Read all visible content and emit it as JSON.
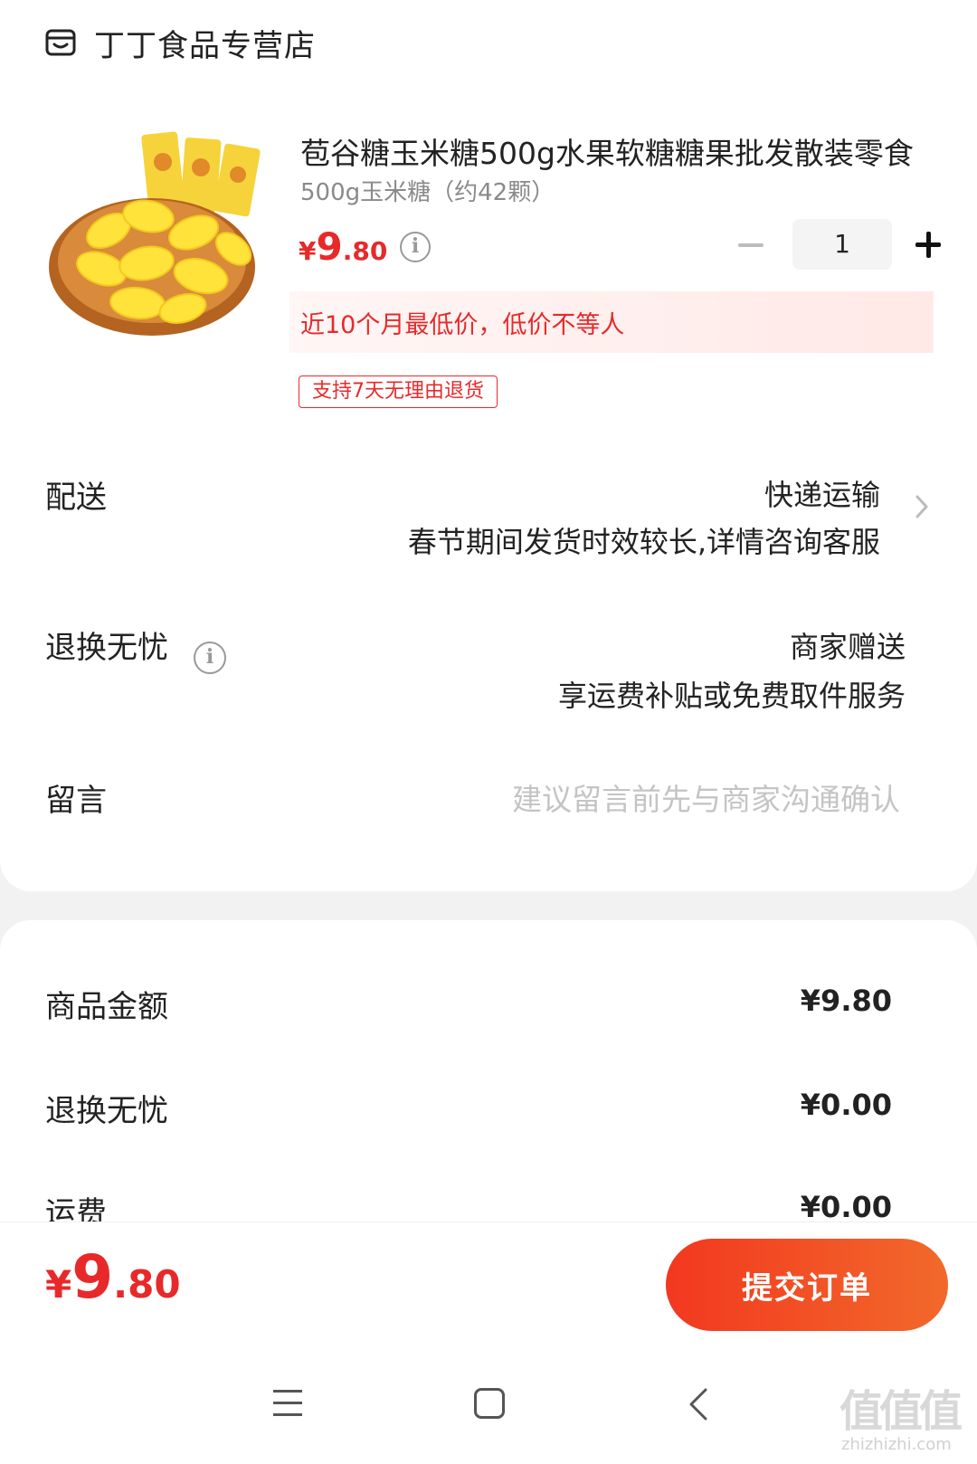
{
  "store": {
    "name": "丁丁食品专营店",
    "icon": "store-icon"
  },
  "product": {
    "title": "苞谷糖玉米糖500g水果软糖糖果批发散装零食",
    "spec": "500g玉米糖（约42颗）",
    "price": {
      "currency": "¥",
      "integer": "9",
      "decimal": ".80"
    },
    "quantity": "1",
    "promo": "近10个月最低价，低价不等人",
    "return_tag": "支持7天无理由退货"
  },
  "delivery": {
    "label": "配送",
    "method": "快递运输",
    "note": "春节期间发货时效较长,详情咨询客服"
  },
  "worry_free": {
    "label": "退换无忧",
    "provider": "商家赠送",
    "desc": "享运费补贴或免费取件服务"
  },
  "message": {
    "label": "留言",
    "placeholder": "建议留言前先与商家沟通确认"
  },
  "summary": {
    "rows": [
      {
        "label": "商品金额",
        "value": "¥9.80"
      },
      {
        "label": "退换无忧",
        "value": "¥0.00"
      },
      {
        "label": "运费",
        "value": "¥0.00"
      }
    ]
  },
  "footer": {
    "total": {
      "currency": "¥",
      "integer": "9",
      "decimal": ".80"
    },
    "submit_label": "提交订单"
  },
  "watermark": {
    "main": "值值值",
    "sub": "zhizhizhi.com"
  },
  "colors": {
    "accent": "#e8292a",
    "button_start": "#f2381f",
    "button_end": "#f2692b"
  }
}
